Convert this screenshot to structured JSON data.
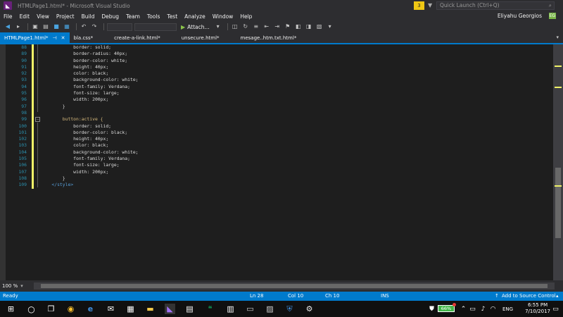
{
  "window": {
    "title": "HTMLPage1.html* - Microsoft Visual Studio",
    "quick_launch_placeholder": "Quick Launch (Ctrl+Q)",
    "user_name": "Eliyahu Georgios",
    "user_initials": "EG",
    "notification_count": "3"
  },
  "menu": [
    "File",
    "Edit",
    "View",
    "Project",
    "Build",
    "Debug",
    "Team",
    "Tools",
    "Test",
    "Analyze",
    "Window",
    "Help"
  ],
  "toolbar": {
    "attach_label": "Attach..."
  },
  "tabs": [
    {
      "label": "HTMLPage1.html*",
      "active": true
    },
    {
      "label": "bla.css*",
      "active": false
    },
    {
      "label": "create-a-link.html*",
      "active": false
    },
    {
      "label": "unsecure.html*",
      "active": false
    },
    {
      "label": "mesage..htm.txt.html*",
      "active": false
    }
  ],
  "editor": {
    "line_numbers": [
      "88",
      "89",
      "90",
      "91",
      "92",
      "93",
      "94",
      "95",
      "96",
      "97",
      "98",
      "99",
      "100",
      "101",
      "102",
      "103",
      "104",
      "105",
      "106",
      "107",
      "108",
      "109"
    ],
    "lines": [
      "            border: solid;",
      "            border-radius: 40px;",
      "            border-color: white;",
      "            height: 40px;",
      "            color: black;",
      "            background-color: white;",
      "            font-family: Verdana;",
      "            font-size: large;",
      "            width: 200px;",
      "        }",
      "",
      "        button:active {",
      "            border: solid;",
      "            border-color: black;",
      "            height: 40px;",
      "            color: black;",
      "            background-color: white;",
      "            font-family: Verdana;",
      "            font-size: large;",
      "            width: 200px;",
      "        }",
      "    </style>"
    ],
    "zoom": "100 %"
  },
  "status": {
    "ready": "Ready",
    "line": "Ln 28",
    "col": "Col 10",
    "ch": "Ch 10",
    "ins": "INS",
    "source_control": "Add to Source Control"
  },
  "taskbar": {
    "battery": "66%",
    "language": "ENG",
    "time": "6:55 PM",
    "date": "7/10/2017"
  },
  "colors": {
    "accent": "#007acc",
    "vs_purple": "#68217a",
    "change_bar": "#eff167",
    "line_number": "#2b91af"
  }
}
